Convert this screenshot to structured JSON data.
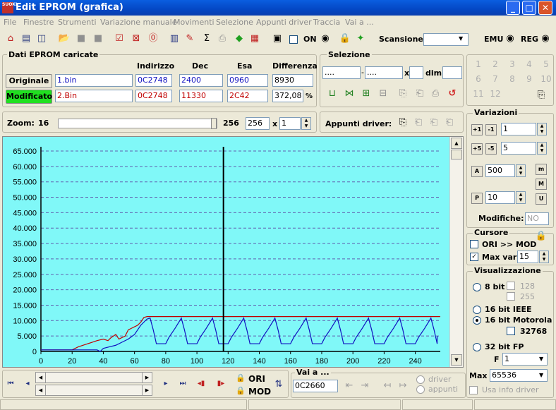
{
  "window": {
    "title": "Edit EPROM (grafica)",
    "logo_text": "SUOKI"
  },
  "menu": [
    "File",
    "Finestre",
    "Strumenti",
    "Variazione manuale",
    "Movimenti",
    "Selezione",
    "Appunti driver",
    "Traccia",
    "Vai a ..."
  ],
  "toolbar": {
    "on_label": "ON",
    "scansione_label": "Scansione",
    "emu_label": "EMU",
    "reg_label": "REG"
  },
  "dati": {
    "group_title": "Dati EPROM caricate",
    "headers": {
      "indirizzo": "Indirizzo",
      "dec": "Dec",
      "esa": "Esa",
      "differenza": "Differenza"
    },
    "originale": {
      "label": "Originale",
      "file": "1.bin",
      "indirizzo": "0C2748",
      "dec": "2400",
      "esa": "0960",
      "differenza": "8930"
    },
    "modificato": {
      "label": "Modificato",
      "file": "2.Bin",
      "indirizzo": "0C2748",
      "dec": "11330",
      "esa": "2C42",
      "differenza": "372,08",
      "unit": "%"
    }
  },
  "selezione": {
    "title": "Selezione",
    "from": "....",
    "to": "....",
    "x_label": "x",
    "dim_label": "dim.",
    "dim_value": ""
  },
  "numpad": [
    "1",
    "2",
    "3",
    "4",
    "5",
    "6",
    "7",
    "8",
    "9",
    "10",
    "11",
    "12"
  ],
  "zoom": {
    "label": "Zoom:",
    "min": "16",
    "max": "256",
    "value": "256",
    "x_label": "x",
    "mult": "1"
  },
  "appunti": {
    "label": "Appunti driver:"
  },
  "variazioni": {
    "title": "Variazioni",
    "v1": "1",
    "v2": "5",
    "v3": "500",
    "v4": "10",
    "btn_m1": "m",
    "btn_m2": "M",
    "btn_u": "U",
    "modifiche_label": "Modifiche:",
    "modifiche_value": "NO"
  },
  "cursore": {
    "title": "Cursore",
    "ori_mod": "ORI >> MOD",
    "max_var_label": "Max var",
    "max_var": "15"
  },
  "visualizzazione": {
    "title": "Visualizzazione",
    "r8": "8 bit",
    "c128": "128",
    "c255": "255",
    "r16ieee": "16 bit IEEE",
    "r16mot": "16 bit Motorola",
    "c32768": "32768",
    "r32fp": "32 bit FP",
    "f_label": "F",
    "f_value": "1",
    "max_label": "Max",
    "max_value": "65536",
    "usa_info": "Usa info driver"
  },
  "bottom": {
    "ori_label": "ORI",
    "mod_label": "MOD",
    "vai_label": "Vai a ...",
    "vai_value": "0C2660",
    "driver_label": "driver",
    "appunti_label": "appunti"
  },
  "chart_data": {
    "type": "line",
    "yticks": [
      "65.000",
      "60.000",
      "55.000",
      "50.000",
      "45.000",
      "40.000",
      "35.000",
      "30.000",
      "25.000",
      "20.000",
      "15.000",
      "10.000",
      "5.000",
      "0"
    ],
    "xticks": [
      "0",
      "20",
      "40",
      "60",
      "80",
      "100",
      "120",
      "140",
      "160",
      "180",
      "200",
      "220",
      "240"
    ],
    "xlim": [
      0,
      256
    ],
    "ylim": [
      0,
      65000
    ],
    "cursor_x": 117,
    "colors": {
      "background": "#80f8f8",
      "grid": "#6060b0",
      "ori": "#c00000",
      "mod": "#1010c0",
      "cursor": "#000000"
    },
    "series": [
      {
        "key": "ori",
        "x": [
          0,
          18,
          20,
          24,
          30,
          36,
          40,
          43,
          45,
          48,
          50,
          52,
          54,
          56,
          58,
          60,
          62,
          64,
          66,
          68,
          70,
          256
        ],
        "y": [
          500,
          500,
          500,
          1500,
          2500,
          3500,
          4000,
          3500,
          4500,
          5500,
          4000,
          4500,
          5000,
          7000,
          7500,
          8000,
          8500,
          9500,
          11000,
          11300,
          11300,
          11300
        ]
      },
      {
        "key": "mod",
        "x": [
          0,
          18,
          20,
          24,
          30,
          36,
          38,
          40,
          44,
          48,
          52,
          56,
          60,
          62,
          64,
          66,
          68,
          70,
          256
        ],
        "y": [
          500,
          500,
          500,
          500,
          500,
          500,
          0,
          1000,
          1500,
          2000,
          3000,
          4000,
          5500,
          7000,
          8500,
          9500,
          10500,
          10800,
          10800
        ],
        "period": [
          70,
          254,
          20
        ]
      }
    ]
  }
}
